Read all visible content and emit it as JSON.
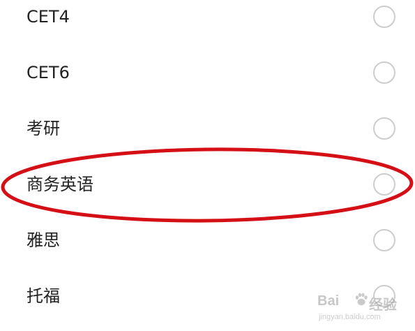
{
  "options": [
    {
      "label": "CET4",
      "selected": false
    },
    {
      "label": "CET6",
      "selected": false
    },
    {
      "label": "考研",
      "selected": false
    },
    {
      "label": "商务英语",
      "selected": false
    },
    {
      "label": "雅思",
      "selected": false
    },
    {
      "label": "托福",
      "selected": false
    }
  ],
  "highlight": {
    "target_option": "商务英语",
    "color": "#d50f16"
  },
  "watermark": {
    "brand_left": "Bai",
    "brand_right": "经验",
    "url": "jingyan.baidu.com"
  },
  "colors": {
    "text": "#222222",
    "radio_border": "#cccccc",
    "background": "#ffffff"
  }
}
